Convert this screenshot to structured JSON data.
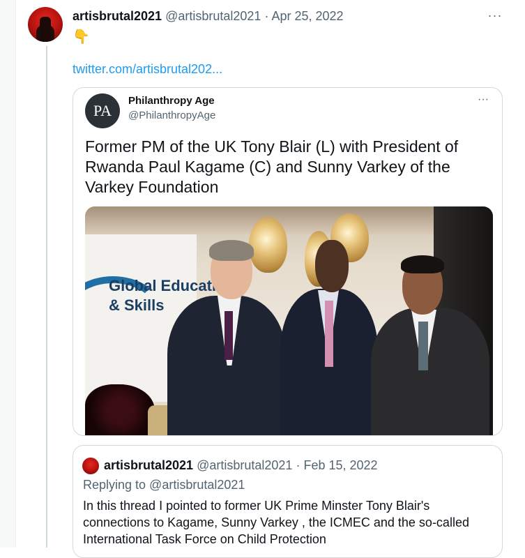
{
  "tweet": {
    "author_name": "artisbrutal2021",
    "author_handle": "@artisbrutal2021",
    "separator": " · ",
    "date": "Apr 25, 2022",
    "emoji": "👇",
    "link_text": "twitter.com/artisbrutal202...",
    "more_label": "···"
  },
  "quoted_tweet": {
    "logo_text": "PA",
    "author_name": "Philanthropy Age",
    "author_handle": "@PhilanthropyAge",
    "more_label": "···",
    "text": "Former PM of the UK Tony Blair (L) with President of Rwanda Paul Kagame (C) and Sunny Varkey of the Varkey Foundation",
    "photo_banner_line1": "Global Educati",
    "photo_banner_line2": "& Skills"
  },
  "nested_quote": {
    "author_name": "artisbrutal2021",
    "author_handle": "@artisbrutal2021",
    "separator": " · ",
    "date": "Feb 15, 2022",
    "replying_to": "Replying to @artisbrutal2021",
    "text": "In this thread I pointed to former UK Prime Minster Tony Blair's connections to Kagame, Sunny Varkey , the ICMEC and the so-called International Task Force on Child Protection"
  },
  "colors": {
    "link": "#1d9bf0",
    "secondary_text": "#536471",
    "border": "#cfd9de"
  }
}
